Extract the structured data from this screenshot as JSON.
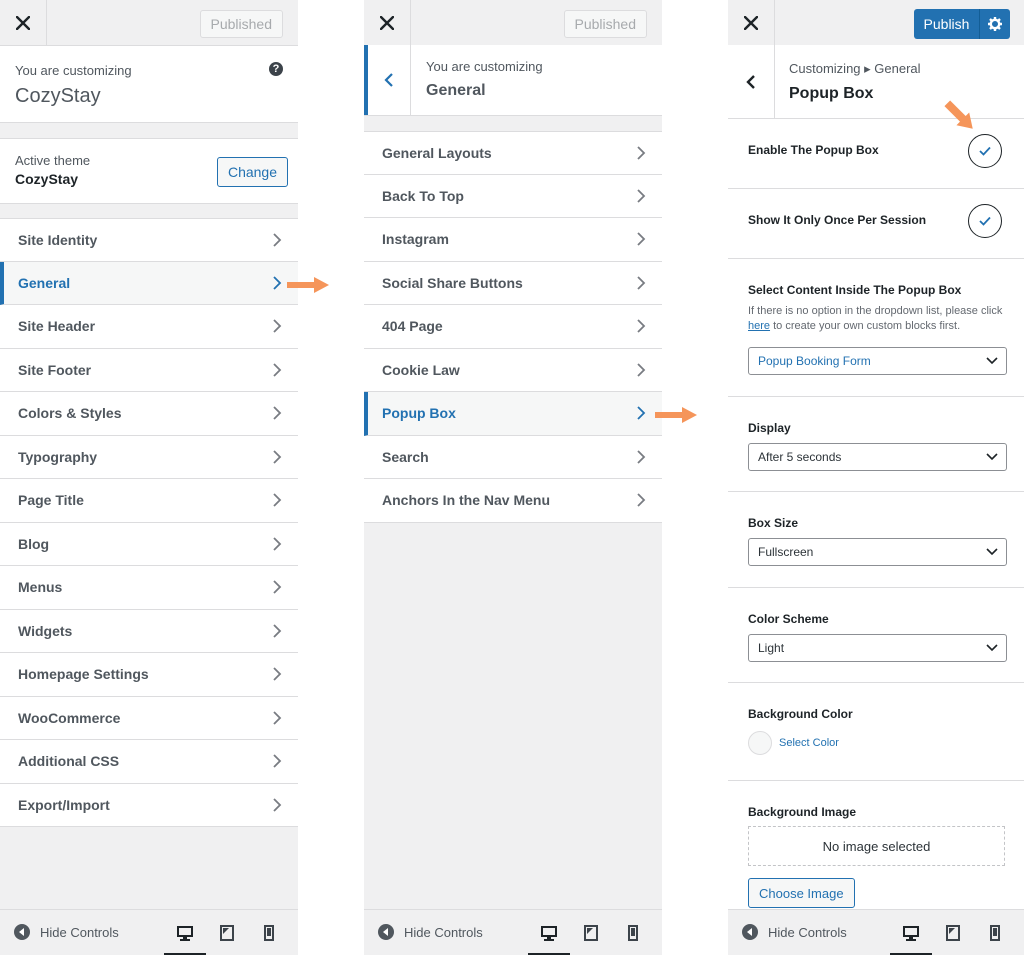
{
  "panel1": {
    "published_label": "Published",
    "customizing_label": "You are customizing",
    "site_name": "CozyStay",
    "help_icon": "?",
    "active_theme_label": "Active theme",
    "active_theme_name": "CozyStay",
    "change_label": "Change",
    "menu": [
      {
        "label": "Site Identity"
      },
      {
        "label": "General"
      },
      {
        "label": "Site Header"
      },
      {
        "label": "Site Footer"
      },
      {
        "label": "Colors & Styles"
      },
      {
        "label": "Typography"
      },
      {
        "label": "Page Title"
      },
      {
        "label": "Blog"
      },
      {
        "label": "Menus"
      },
      {
        "label": "Widgets"
      },
      {
        "label": "Homepage Settings"
      },
      {
        "label": "WooCommerce"
      },
      {
        "label": "Additional CSS"
      },
      {
        "label": "Export/Import"
      }
    ],
    "active_item": "General"
  },
  "panel2": {
    "published_label": "Published",
    "customizing_label": "You are customizing",
    "section_title": "General",
    "menu": [
      {
        "label": "General Layouts"
      },
      {
        "label": "Back To Top"
      },
      {
        "label": "Instagram"
      },
      {
        "label": "Social Share Buttons"
      },
      {
        "label": "404 Page"
      },
      {
        "label": "Cookie Law"
      },
      {
        "label": "Popup Box"
      },
      {
        "label": "Search"
      },
      {
        "label": "Anchors In the Nav Menu"
      }
    ],
    "active_item": "Popup Box"
  },
  "panel3": {
    "publish_label": "Publish",
    "breadcrumb": "Customizing ▸ General",
    "section_title": "Popup Box",
    "enable_label": "Enable The Popup Box",
    "enable_checked": true,
    "once_label": "Show It Only Once Per Session",
    "once_checked": true,
    "content_label": "Select Content Inside The Popup Box",
    "content_desc_1": "If there is no option in the dropdown list, please click",
    "content_desc_link": "here",
    "content_desc_2": "to create your own custom blocks first.",
    "content_value": "Popup Booking Form",
    "display_label": "Display",
    "display_value": "After 5 seconds",
    "box_size_label": "Box Size",
    "box_size_value": "Fullscreen",
    "color_scheme_label": "Color Scheme",
    "color_scheme_value": "Light",
    "bg_color_label": "Background Color",
    "select_color_label": "Select Color",
    "bg_image_label": "Background Image",
    "no_image_label": "No image selected",
    "choose_image_label": "Choose Image"
  },
  "footer": {
    "hide_controls_label": "Hide Controls",
    "devices": [
      "desktop-icon",
      "tablet-icon",
      "mobile-icon"
    ],
    "active_device": "desktop"
  },
  "colors": {
    "accent": "#2271b1",
    "arrow": "#f5955a",
    "panel_bg": "#f0f0f1"
  }
}
